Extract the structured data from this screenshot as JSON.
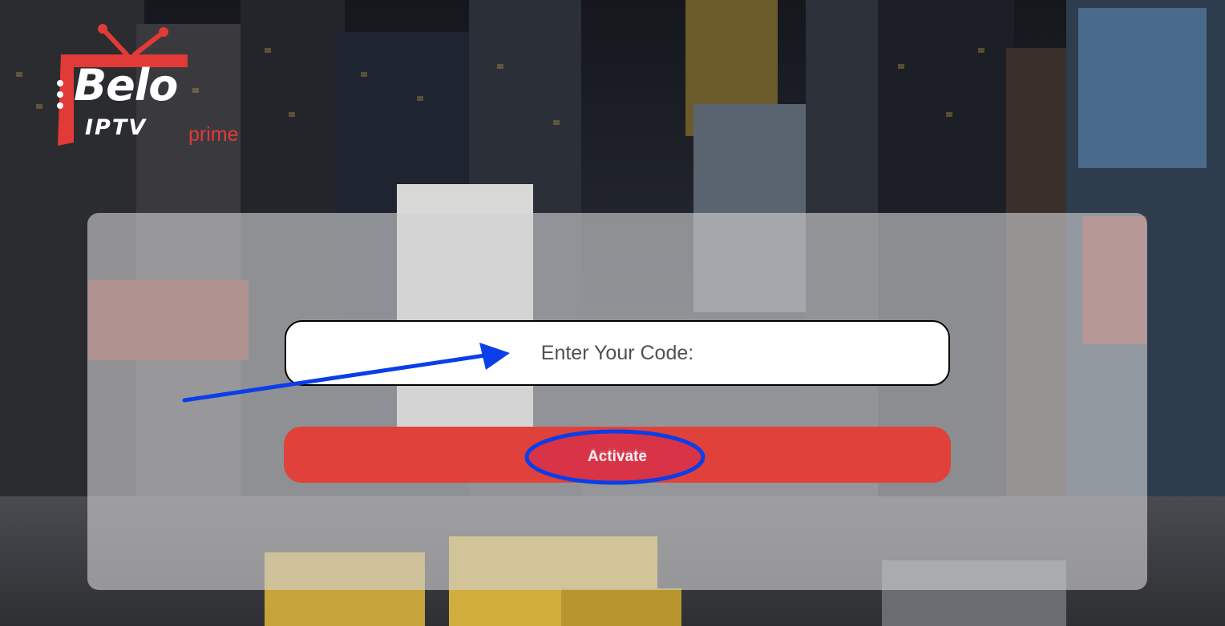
{
  "logo": {
    "brand": "Belo",
    "product": "IPTV",
    "tier": "prime"
  },
  "form": {
    "code_placeholder": "Enter Your Code:",
    "code_value": "",
    "activate_label": "Activate"
  },
  "colors": {
    "accent": "#e0413b",
    "button_highlight": "#d6314a",
    "annotation": "#0a3ee8",
    "panel": "#d2d2d4"
  },
  "icons": {
    "logo_antenna": "tv-antenna-icon",
    "arrow": "arrow-annotation",
    "circle": "circle-annotation"
  }
}
